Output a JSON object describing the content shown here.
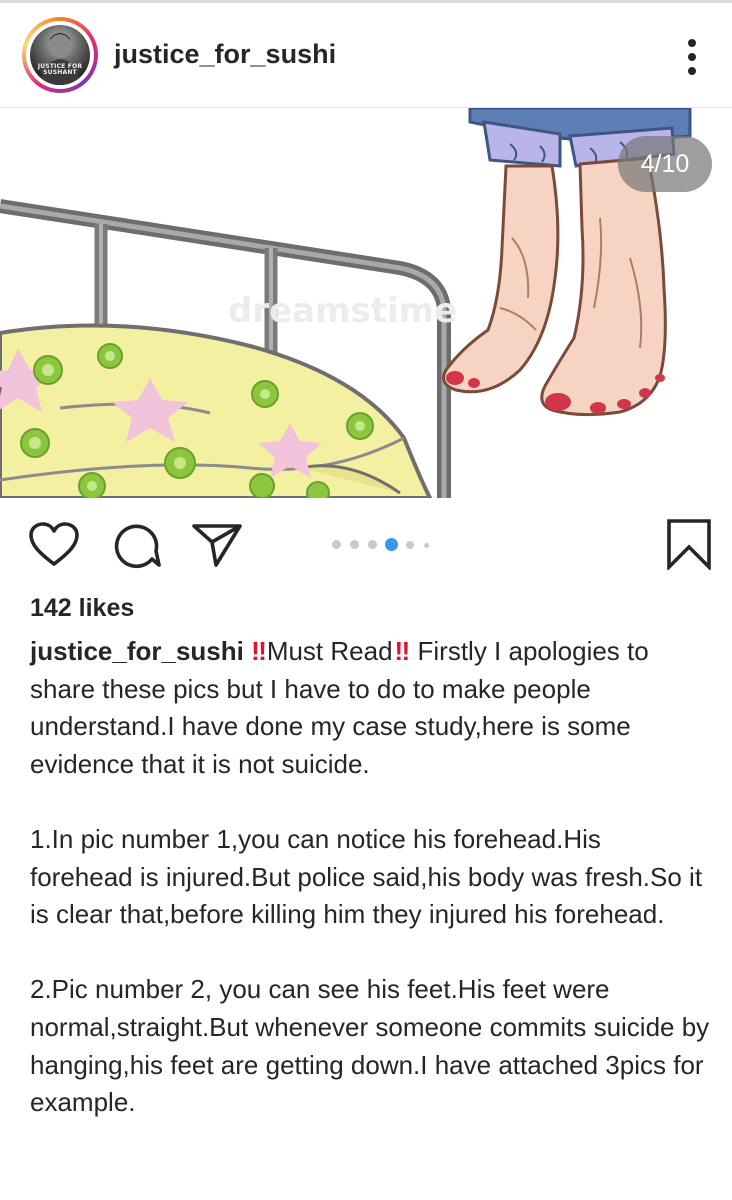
{
  "post": {
    "username": "justice_for_sushi",
    "avatar_text": "JUSTICE FOR SUSHANT",
    "image_counter": "4/10",
    "carousel": {
      "total_dots": 6,
      "active_index": 3
    },
    "likes": "142 likes",
    "caption": {
      "username": "justice_for_sushi",
      "emphasis_mark": "‼",
      "headline": "Must Read",
      "intro": "Firstly I apologies to share these pics but I have to do to make people understand.I have done my case study,here is  some evidence that it is not suicide.",
      "point1": "1.In pic number 1,you can notice his forehead.His forehead is injured.But police said,his body was fresh.So it is clear that,before killing him they injured his forehead.",
      "point2": "2.Pic number 2, you can see his feet.His feet were normal,straight.But whenever someone commits suicide by hanging,his feet are getting down.I have attached 3pics for example."
    },
    "watermark": "dreamstime"
  },
  "icons": {
    "more": "more-vertical-icon",
    "like": "heart-icon",
    "comment": "comment-icon",
    "share": "share-icon",
    "save": "bookmark-icon"
  },
  "colors": {
    "text": "#262626",
    "accent_blue": "#3897f0",
    "emphasis_red": "#e0132e",
    "badge_bg": "#787878"
  }
}
